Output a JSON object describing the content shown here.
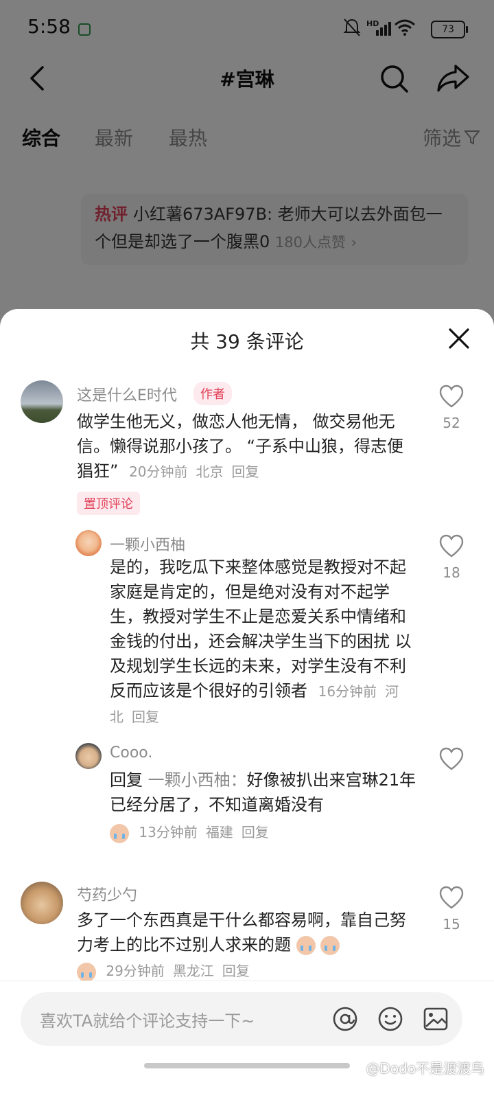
{
  "status_bar": {
    "time": "5:58",
    "network": "HD",
    "battery": "73"
  },
  "header": {
    "title": "#宫琳"
  },
  "tabs": [
    {
      "label": "综合",
      "active": true
    },
    {
      "label": "最新",
      "active": false
    },
    {
      "label": "最热",
      "active": false
    }
  ],
  "filter_label": "筛选",
  "hot_comment": {
    "badge": "热评",
    "user": "小红薯673AF97B:",
    "text": "老师大可以去外面包一个但是却选了一个腹黑0",
    "likes": "180人点赞",
    "chevron": "›"
  },
  "sheet": {
    "title": "共 39 条评论"
  },
  "comments": [
    {
      "user": "这是什么E时代",
      "tag": "作者",
      "text": "做学生他无义，做恋人他无情， 做交易他无信。懒得说那小孩了。 “子系中山狼，得志便猖狂”",
      "time": "20分钟前",
      "location": "北京",
      "reply_label": "回复",
      "pin": "置顶评论",
      "likes": "52"
    },
    {
      "user": "一颗小西柚",
      "text": "是的，我吃瓜下来整体感觉是教授对不起家庭是肯定的，但是绝对没有对不起学生，教授对学生不止是恋爱关系中情绪和金钱的付出，还会解决学生当下的困扰 以及规划学生长远的未来，对学生没有不利 反而应该是个很好的引领者",
      "time": "16分钟前",
      "location": "河北",
      "reply_label": "回复",
      "likes": "18"
    },
    {
      "user": "Cooo.",
      "reply_prefix": "回复",
      "reply_target": "一颗小西柚：",
      "text": "好像被扒出来宫琳21年已经分居了，不知道离婚没有",
      "time": "13分钟前",
      "location": "福建",
      "reply_label": "回复",
      "likes": ""
    },
    {
      "user": "芍药少勺",
      "text": "多了一个东西真是干什么都容易啊，靠自己努力考上的比不过别人求来的题",
      "time": "29分钟前",
      "location": "黑龙江",
      "reply_label": "回复",
      "likes": "15"
    }
  ],
  "input": {
    "placeholder": "喜欢TA就给个评论支持一下~"
  },
  "watermark": "@Dodo不是渡渡鸟",
  "colors": {
    "accent": "#e2425a",
    "overlay": "rgba(0,0,0,0.5)"
  }
}
